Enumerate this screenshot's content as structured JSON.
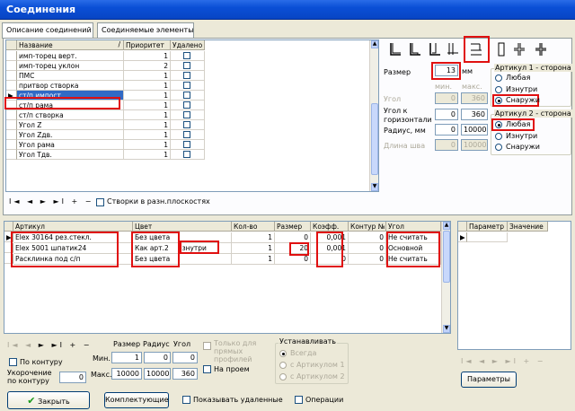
{
  "window": {
    "title": "Соединения"
  },
  "tabs": [
    {
      "label": "Описание соединений"
    },
    {
      "label": "Соединяемые элементы"
    }
  ],
  "top_grid": {
    "columns": [
      "Название",
      "Приоритет",
      "Удалено"
    ],
    "rows": [
      {
        "name": "имп-торец верт.",
        "priority": "1"
      },
      {
        "name": "имп-торец уклон",
        "priority": "2"
      },
      {
        "name": "ПМС",
        "priority": "1"
      },
      {
        "name": "притвор створка",
        "priority": "1"
      },
      {
        "name": "ст/п импост",
        "priority": "1"
      },
      {
        "name": "ст/п рама",
        "priority": "1"
      },
      {
        "name": "ст/п створка",
        "priority": "1"
      },
      {
        "name": "Угол Z",
        "priority": "1"
      },
      {
        "name": "Угол Zдв.",
        "priority": "1"
      },
      {
        "name": "Угол рама",
        "priority": "1"
      },
      {
        "name": "Угол Тдв.",
        "priority": "1"
      }
    ],
    "nav": "I◄ ◄ ► ►I + −",
    "stvorki_label": "Створки в разн.плоскостях"
  },
  "right_panel": {
    "size_label": "Размер",
    "size_value": "13",
    "size_unit": "мм",
    "min_label": "мин.",
    "max_label": "макс.",
    "angle_label": "Угол",
    "angle_min": "0",
    "angle_max": "360",
    "horiz_label": "Угол к горизонтали",
    "horiz_min": "0",
    "horiz_max": "360",
    "radius_label": "Радиус, мм",
    "radius_min": "0",
    "radius_max": "10000",
    "seam_label": "Длина шва",
    "seam_min": "0",
    "seam_max": "10000",
    "art1": {
      "title": "Артикул 1 - сторона",
      "options": [
        "Любая",
        "Изнутри",
        "Снаружи"
      ],
      "selected": 2
    },
    "art2": {
      "title": "Артикул 2 - сторона",
      "options": [
        "Любая",
        "Изнутри",
        "Снаружи"
      ],
      "selected": 0
    }
  },
  "bottom_grid": {
    "columns": [
      "Артикул",
      "Цвет",
      "Кол-во",
      "Размер",
      "Коэфф.",
      "Контур №",
      "Угол"
    ],
    "rows": [
      {
        "article": "Elex 30164 рез.стекл.",
        "color": "Без цвета",
        "qty": "1",
        "size": "0",
        "coef": "0,001",
        "contour": "0",
        "angle": "Не считать"
      },
      {
        "article": "Elex 5001 шпатик24",
        "color": "Как арт.2",
        "color2": "изнутри",
        "qty": "1",
        "size": "20",
        "coef": "0,001",
        "contour": "0",
        "angle": "Основной"
      },
      {
        "article": "Расклинка под с/п",
        "color": "Без цвета",
        "qty": "1",
        "size": "0",
        "coef": "0",
        "contour": "0",
        "angle": "Не считать"
      }
    ]
  },
  "param_grid": {
    "columns": [
      "Параметр",
      "Значение"
    ]
  },
  "bottom_controls": {
    "nav": "I◄ ◄ ► ►I + −",
    "by_contour": "По контуру",
    "shortening_label": "Укорочение по контуру",
    "shortening_value": "0",
    "size_hdr": "Размер",
    "radius_hdr": "Радиус",
    "angle_hdr": "Угол",
    "min_label": "Мин.",
    "max_label": "Макс.",
    "min_size": "1",
    "min_radius": "0",
    "min_angle": "0",
    "max_size": "10000",
    "max_radius": "10000",
    "max_angle": "360",
    "only_straight": "Только для прямых профилей",
    "on_opening": "На проем",
    "install_title": "Устанавливать",
    "install_options": [
      "Всегда",
      "с Артикулом 1",
      "с Артикулом 2"
    ],
    "params_button": "Параметры",
    "close_button": "Закрыть",
    "kit_button": "Комплектующие",
    "show_deleted": "Показывать удаленные",
    "operations": "Операции"
  }
}
